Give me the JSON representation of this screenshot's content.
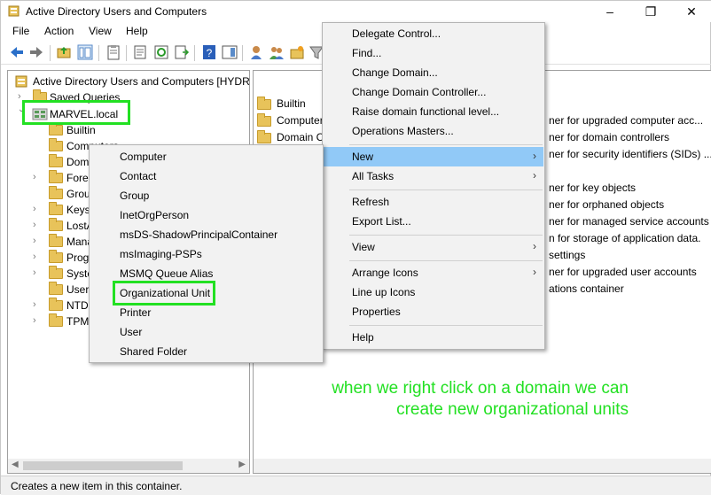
{
  "window": {
    "title": "Active Directory Users and Computers",
    "minimize": "–",
    "restore": "❐",
    "close": "✕"
  },
  "menubar": {
    "items": [
      "File",
      "Action",
      "View",
      "Help"
    ]
  },
  "tree": {
    "root": "Active Directory Users and Computers [HYDRA",
    "items": [
      "Saved Queries",
      "MARVEL.local",
      "Builtin",
      "Computers",
      "Domain Controllers",
      "ForeignSecurityPrincipals",
      "Group",
      "Keys",
      "LostAndFound",
      "Managed Service Accounts",
      "Program Data",
      "System",
      "Users",
      "NTDS Quotas",
      "TPM Devices"
    ],
    "visible_labels": [
      "Saved Queries",
      "MARVEL.local",
      "Builtin",
      "Computers",
      "Dom",
      "Forei",
      "Grou",
      "Keys",
      "LostA",
      "Mana",
      "Prog",
      "Syste",
      "Users",
      "NTDS",
      "TPM"
    ]
  },
  "right_pane": {
    "names": [
      "Builtin",
      "Computer",
      "Domain C"
    ],
    "descriptions": [
      "ner for upgraded computer acc...",
      "ner for domain controllers",
      "ner for security identifiers (SIDs) ...",
      "ner for key objects",
      "ner for orphaned objects",
      "ner for managed service accounts",
      "n for storage of application data.",
      "settings",
      "ner for upgraded user accounts",
      "ations container"
    ]
  },
  "context_menu_main": {
    "items": [
      "Delegate Control...",
      "Find...",
      "Change Domain...",
      "Change Domain Controller...",
      "Raise domain functional level...",
      "Operations Masters...",
      "New",
      "All Tasks",
      "Refresh",
      "Export List...",
      "View",
      "Arrange Icons",
      "Line up Icons",
      "Properties",
      "Help"
    ],
    "highlighted": "New",
    "submenu_arrow": "›"
  },
  "context_menu_new": {
    "items": [
      "Computer",
      "Contact",
      "Group",
      "InetOrgPerson",
      "msDS-ShadowPrincipalContainer",
      "msImaging-PSPs",
      "MSMQ Queue Alias",
      "Organizational Unit",
      "Printer",
      "User",
      "Shared Folder"
    ]
  },
  "annotation": {
    "line1": "when we right click on a domain we can",
    "line2": "create new organizational units",
    "color": "#22e022"
  },
  "status": {
    "text": "Creates a new item in this container."
  },
  "colors": {
    "highlight": "#91c9f7",
    "annotation": "#22e022",
    "folder": "#e8c35a"
  }
}
